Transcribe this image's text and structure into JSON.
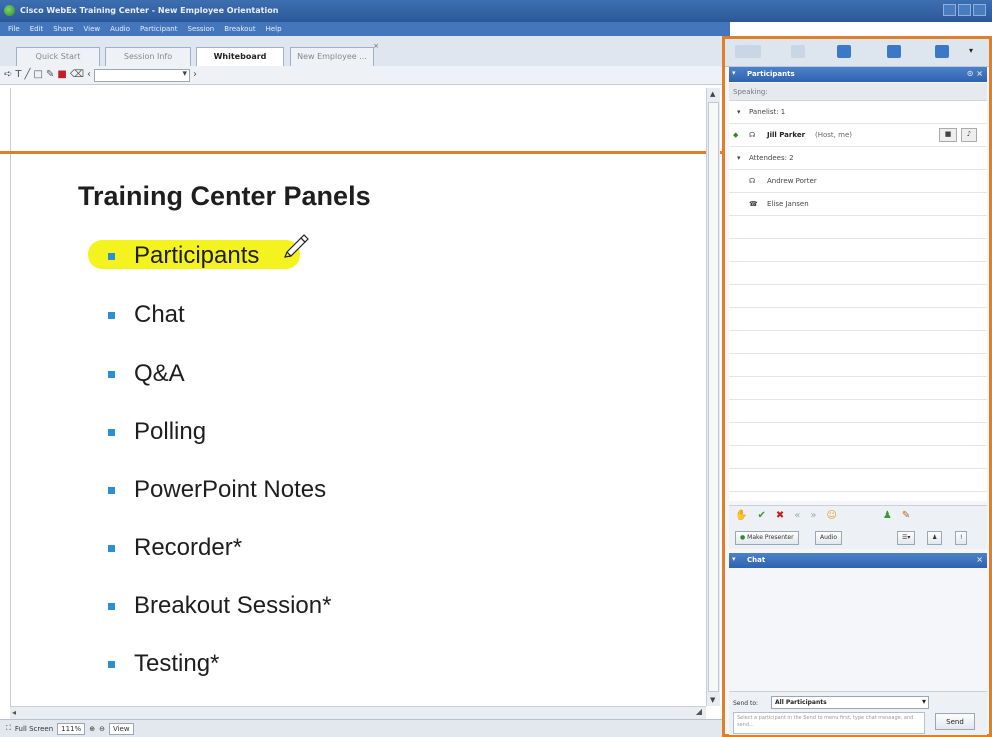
{
  "window": {
    "title": "Cisco WebEx Training Center - New Employee Orientation"
  },
  "menu": [
    "File",
    "Edit",
    "Share",
    "View",
    "Audio",
    "Participant",
    "Session",
    "Breakout",
    "Help"
  ],
  "tabs": [
    {
      "label": "Quick Start"
    },
    {
      "label": "Session Info"
    },
    {
      "label": "Whiteboard"
    },
    {
      "label": "New Employee ..."
    }
  ],
  "toolbar": {
    "font_select": ""
  },
  "slide": {
    "title": "Training Center Panels",
    "bullets": [
      "Participants",
      "Chat",
      "Q&A",
      "Polling",
      "PowerPoint Notes",
      "Recorder*",
      "Breakout Session*",
      "Testing*"
    ]
  },
  "statusbar": {
    "full_screen": "Full Screen",
    "zoom": "111%",
    "view": "View"
  },
  "participants_panel": {
    "title": "Participants",
    "speaking": "Speaking:",
    "panelists_group": "Panelist: 1",
    "host": {
      "name": "Jill Parker",
      "role": "(Host, me)"
    },
    "attendees_group": "Attendees: 2",
    "attendees": [
      "Andrew Porter",
      "Elise Jansen"
    ],
    "make_presenter": "Make Presenter",
    "audio": "Audio"
  },
  "chat_panel": {
    "title": "Chat",
    "send_to_label": "Send to:",
    "send_to_value": "All Participants",
    "input_placeholder": "Select a participant in the Send to menu first, type chat message, and send...",
    "send_button": "Send"
  },
  "colors": {
    "accent_orange": "#e07f2a",
    "title_blue": "#2f62ad",
    "bullet_blue": "#2a8fd3",
    "highlight_yellow": "#f4f31f"
  }
}
